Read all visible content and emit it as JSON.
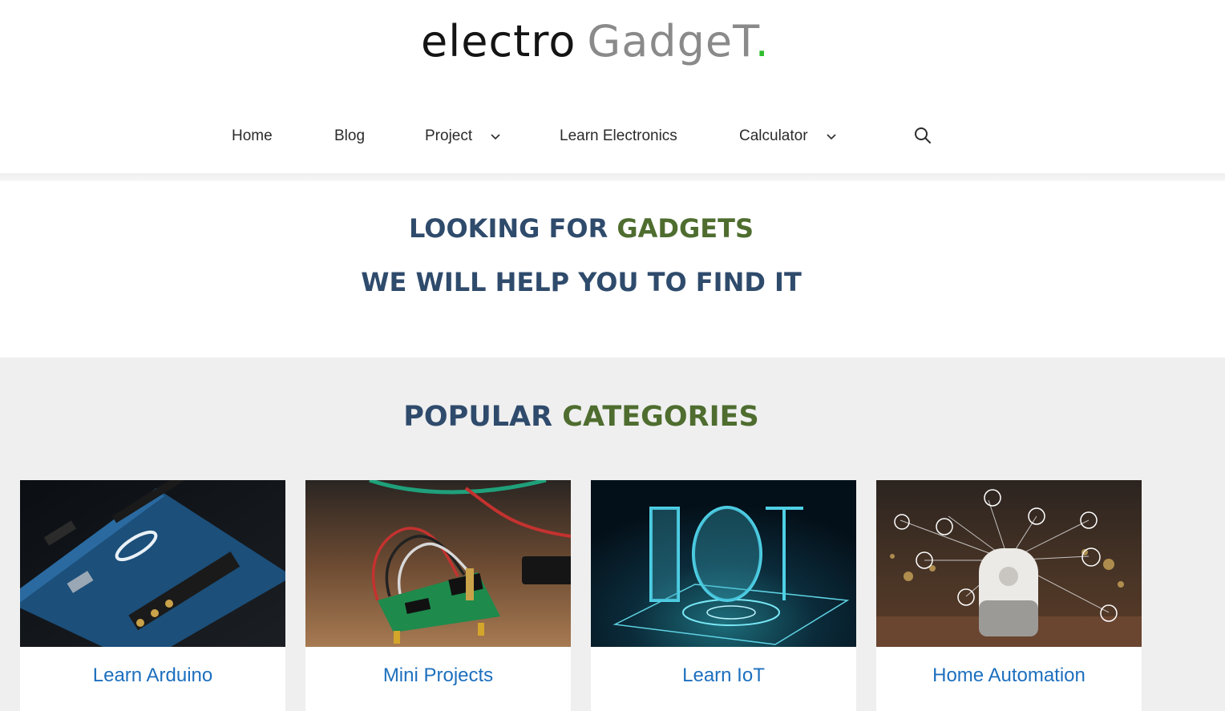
{
  "header": {
    "logo": {
      "word1": "electro",
      "word2": "GadgeT",
      "dot": "."
    },
    "nav": [
      {
        "label": "Home"
      },
      {
        "label": "Blog"
      },
      {
        "label": "Project"
      },
      {
        "label": "Learn Electronics"
      },
      {
        "label": "Calculator"
      }
    ],
    "search_icon": "search-icon"
  },
  "hero": {
    "line1_a": "LOOKING FOR ",
    "line1_b": "GADGETS",
    "line2": "WE WILL HELP YOU TO FIND IT"
  },
  "categories": {
    "title_a": "POPULAR ",
    "title_b": "CATEGORIES",
    "items": [
      {
        "label": "Learn Arduino"
      },
      {
        "label": "Mini Projects"
      },
      {
        "label": "Learn IoT"
      },
      {
        "label": "Home Automation"
      }
    ]
  },
  "colors": {
    "navy": "#2f4b6c",
    "olive": "#4e6d2f",
    "link_blue": "#1d6fbe",
    "logo_dot": "#2fbd2b"
  }
}
